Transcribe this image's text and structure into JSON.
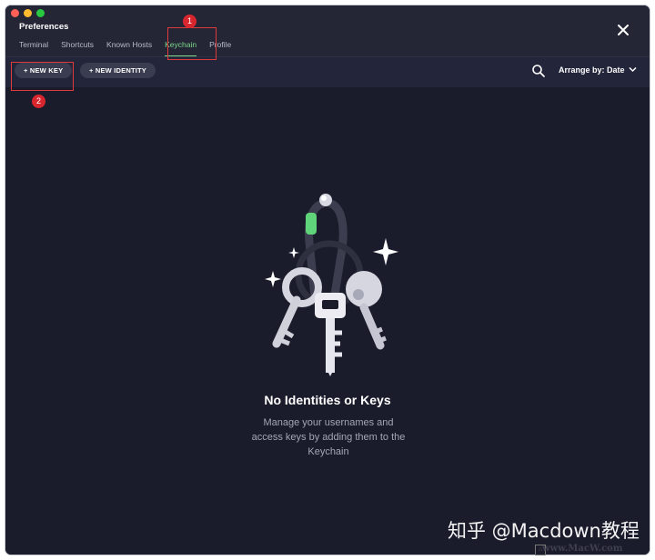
{
  "window": {
    "title": "Preferences",
    "tabs": [
      {
        "label": "Terminal",
        "active": false
      },
      {
        "label": "Shortcuts",
        "active": false
      },
      {
        "label": "Known Hosts",
        "active": false
      },
      {
        "label": "Keychain",
        "active": true
      },
      {
        "label": "Profile",
        "active": false
      }
    ],
    "accent_color": "#7cd88a"
  },
  "toolbar": {
    "new_key_label": "+ NEW KEY",
    "new_identity_label": "+ NEW IDENTITY",
    "arrange_label": "Arrange by: Date"
  },
  "empty_state": {
    "title": "No Identities or Keys",
    "description": "Manage your usernames and access keys by adding them to the Keychain"
  },
  "annotations": {
    "marker_1": "1",
    "marker_2": "2"
  },
  "watermark": {
    "text": "知乎 @Macdown教程",
    "site": "www.MacW.com"
  }
}
